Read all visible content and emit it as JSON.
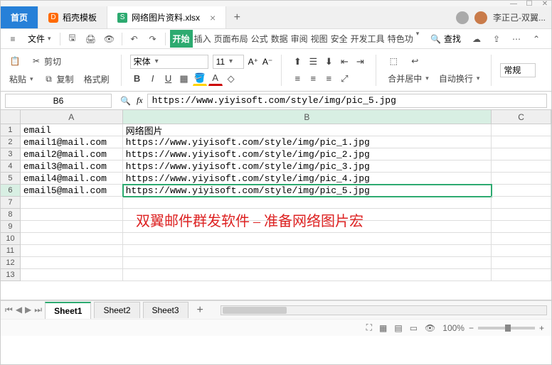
{
  "window": {
    "app_hint": "WPS"
  },
  "tabs": {
    "home": "首页",
    "second": "稻壳模板",
    "file": "网络图片资料.xlsx",
    "user": "李正己-双翼..."
  },
  "menubar": {
    "file": "文件",
    "find": "查找",
    "ribbon": [
      "开始",
      "插入",
      "页面布局",
      "公式",
      "数据",
      "审阅",
      "视图",
      "安全",
      "开发工具",
      "特色功"
    ]
  },
  "ribbon": {
    "cut": "剪切",
    "paste": "粘贴",
    "copy": "复制",
    "format": "格式刷",
    "font": "宋体",
    "size": "11",
    "merge": "合并居中",
    "wrap": "自动换行",
    "mode": "常规"
  },
  "namebox": "B6",
  "formula": "https://www.yiyisoft.com/style/img/pic_5.jpg",
  "cols": [
    "A",
    "B",
    "C"
  ],
  "rows": [
    {
      "n": "1",
      "a": "email",
      "b": "网络图片"
    },
    {
      "n": "2",
      "a": "email1@mail.com",
      "b": "https://www.yiyisoft.com/style/img/pic_1.jpg"
    },
    {
      "n": "3",
      "a": "email2@mail.com",
      "b": "https://www.yiyisoft.com/style/img/pic_2.jpg"
    },
    {
      "n": "4",
      "a": "email3@mail.com",
      "b": "https://www.yiyisoft.com/style/img/pic_3.jpg"
    },
    {
      "n": "5",
      "a": "email4@mail.com",
      "b": "https://www.yiyisoft.com/style/img/pic_4.jpg"
    },
    {
      "n": "6",
      "a": "email5@mail.com",
      "b": "https://www.yiyisoft.com/style/img/pic_5.jpg"
    },
    {
      "n": "7",
      "a": "",
      "b": ""
    },
    {
      "n": "8",
      "a": "",
      "b": ""
    },
    {
      "n": "9",
      "a": "",
      "b": ""
    },
    {
      "n": "10",
      "a": "",
      "b": ""
    },
    {
      "n": "11",
      "a": "",
      "b": ""
    },
    {
      "n": "12",
      "a": "",
      "b": ""
    },
    {
      "n": "13",
      "a": "",
      "b": ""
    }
  ],
  "overlay": "双翼邮件群发软件 – 准备网络图片宏",
  "sheets": [
    "Sheet1",
    "Sheet2",
    "Sheet3"
  ],
  "status": {
    "zoom": "100%"
  }
}
